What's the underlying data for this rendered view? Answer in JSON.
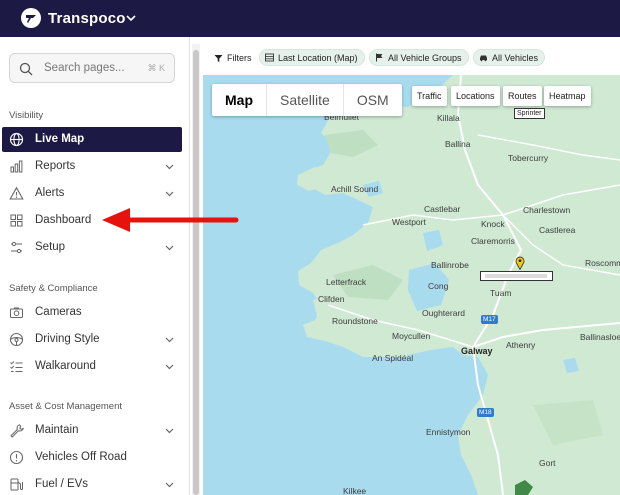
{
  "brand": {
    "name": "Transpoco"
  },
  "search": {
    "placeholder": "Search pages...",
    "shortcut": "⌘ K"
  },
  "sidebar": {
    "sections": [
      {
        "title": "Visibility"
      },
      {
        "title": "Safety & Compliance"
      },
      {
        "title": "Asset & Cost Management"
      }
    ],
    "items": [
      {
        "label": "Live Map",
        "icon": "globe-icon",
        "active": true
      },
      {
        "label": "Reports",
        "icon": "bar-chart-icon",
        "chevron": true
      },
      {
        "label": "Alerts",
        "icon": "warning-icon",
        "chevron": true
      },
      {
        "label": "Dashboard",
        "icon": "grid-icon"
      },
      {
        "label": "Setup",
        "icon": "sliders-icon",
        "chevron": true
      },
      {
        "label": "Cameras",
        "icon": "camera-icon"
      },
      {
        "label": "Driving Style",
        "icon": "steering-wheel-icon",
        "chevron": true
      },
      {
        "label": "Walkaround",
        "icon": "checklist-icon",
        "chevron": true
      },
      {
        "label": "Maintain",
        "icon": "wrench-icon",
        "chevron": true
      },
      {
        "label": "Vehicles Off Road",
        "icon": "alert-circle-icon"
      },
      {
        "label": "Fuel / EVs",
        "icon": "fuel-icon",
        "chevron": true
      }
    ]
  },
  "filters": {
    "label": "Filters",
    "chips": [
      {
        "label": "Last Location (Map)",
        "icon": "table-icon"
      },
      {
        "label": "All Vehicle Groups",
        "icon": "flag-icon"
      },
      {
        "label": "All Vehicles",
        "icon": "car-icon"
      }
    ]
  },
  "map": {
    "types": [
      "Map",
      "Satellite",
      "OSM"
    ],
    "selected_type": "Map",
    "overlays": [
      "Traffic",
      "Locations",
      "Routes",
      "Heatmap"
    ],
    "tooltip": "Sprinter",
    "roads": [
      "M17",
      "M18"
    ],
    "places": [
      "Belmullet",
      "Killala",
      "Ballina",
      "Tobercurry",
      "Achill Sound",
      "Castlebar",
      "Westport",
      "Knock",
      "Charlestown",
      "Claremorris",
      "Castlerea",
      "Ballinrobe",
      "Roscommon",
      "Cong",
      "Tuam",
      "Letterfrack",
      "Clifden",
      "Roundstone",
      "Oughterard",
      "Moycullen",
      "Galway",
      "An Spidéal",
      "Athenry",
      "Ballinasloe",
      "Ennistymon",
      "Gort",
      "Kilkee"
    ]
  },
  "colors": {
    "topbar": "#1c1a45",
    "active_item": "#1c1a45",
    "chip_bg": "#e6f1ec",
    "water": "#a9dbef",
    "land": "#cfe9d3",
    "annotation_arrow": "#e5120e"
  }
}
